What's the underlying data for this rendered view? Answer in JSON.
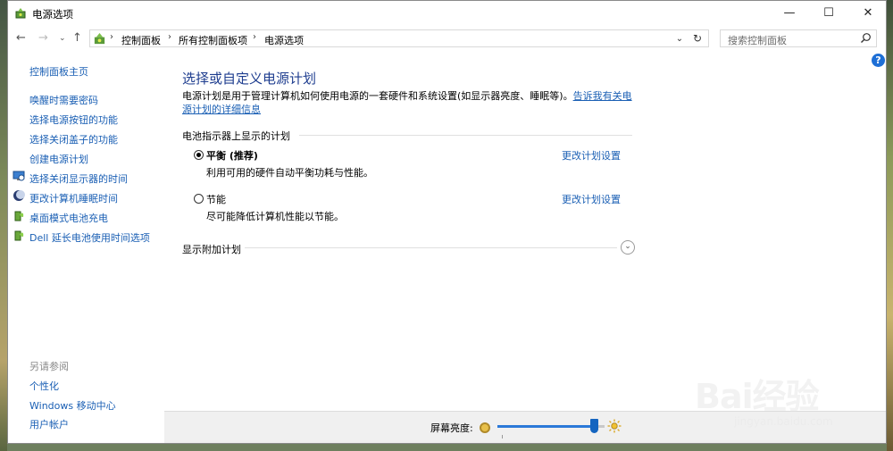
{
  "window": {
    "title": "电源选项"
  },
  "address": {
    "crumbs": [
      "控制面板",
      "所有控制面板项",
      "电源选项"
    ],
    "search_placeholder": "搜索控制面板"
  },
  "sidebar": {
    "home": "控制面板主页",
    "items": [
      {
        "label": "唤醒时需要密码",
        "icon": null
      },
      {
        "label": "选择电源按钮的功能",
        "icon": null
      },
      {
        "label": "选择关闭盖子的功能",
        "icon": null
      },
      {
        "label": "创建电源计划",
        "icon": null
      },
      {
        "label": "选择关闭显示器的时间",
        "icon": "monitor-clock-icon"
      },
      {
        "label": "更改计算机睡眠时间",
        "icon": "moon-icon"
      },
      {
        "label": "桌面模式电池充电",
        "icon": "battery-leaf-icon"
      },
      {
        "label": "Dell 延长电池使用时间选项",
        "icon": "battery-leaf-icon"
      }
    ],
    "see_also_title": "另请参阅",
    "see_also": [
      "个性化",
      "Windows 移动中心",
      "用户帐户"
    ]
  },
  "main": {
    "title": "选择或自定义电源计划",
    "description": "电源计划是用于管理计算机如何使用电源的一套硬件和系统设置(如显示器亮度、睡眠等)。",
    "description_link": "告诉我有关电源计划的详细信息",
    "group_label": "电池指示器上显示的计划",
    "plans": [
      {
        "name": "平衡 (推荐)",
        "desc": "利用可用的硬件自动平衡功耗与性能。",
        "selected": true,
        "link": "更改计划设置"
      },
      {
        "name": "节能",
        "desc": "尽可能降低计算机性能以节能。",
        "selected": false,
        "link": "更改计划设置"
      }
    ],
    "extra_plans_label": "显示附加计划"
  },
  "brightness": {
    "label": "屏幕亮度:",
    "level": 0.9
  },
  "watermark": {
    "brand": "Bai",
    "brand2": "经验",
    "url": "jingyan.baidu.com"
  },
  "colors": {
    "link": "#1a5fb4",
    "title": "#1e3d8f",
    "slider": "#1565c0"
  }
}
